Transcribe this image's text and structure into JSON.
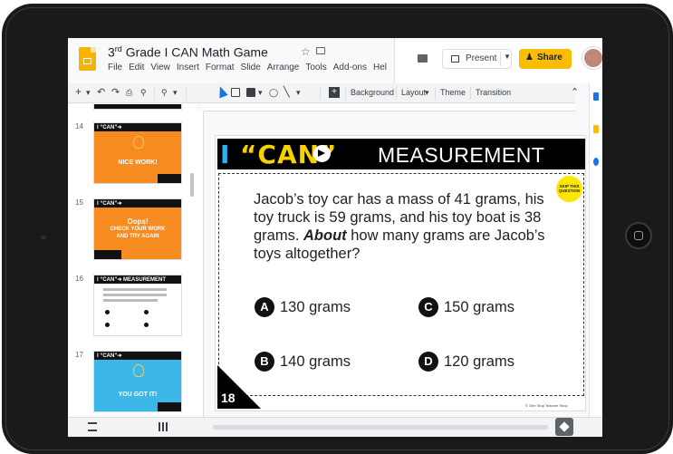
{
  "document": {
    "title_prefix": "3",
    "title_sup": "rd",
    "title_rest": " Grade I CAN Math Game"
  },
  "menu": [
    "File",
    "Edit",
    "View",
    "Insert",
    "Format",
    "Slide",
    "Arrange",
    "Tools",
    "Add-ons",
    "Hel"
  ],
  "header": {
    "present_label": "Present",
    "share_label": "Share"
  },
  "toolbar": {
    "background_label": "Background",
    "layout_label": "Layout",
    "theme_label": "Theme",
    "transition_label": "Transition"
  },
  "filmstrip": {
    "slides": [
      {
        "number": "14",
        "message": "NICE WORK!",
        "color": "#f68b1f"
      },
      {
        "number": "15",
        "message_line1": "Oops!",
        "message_line2": "CHECK YOUR WORK",
        "message_line3": "AND TRY AGAIN",
        "color": "#f68b1f"
      },
      {
        "number": "16",
        "color": "#ffffff"
      },
      {
        "number": "17",
        "message": "YOU GOT IT!",
        "color": "#3bb7e8"
      }
    ]
  },
  "slide": {
    "logo_i": "I",
    "logo_can": "“CAN”",
    "title": "MEASUREMENT",
    "skip_badge_line1": "SKIP THIS",
    "skip_badge_line2": "QUESTION",
    "question_part1": "Jacob’s toy car has a mass of 41 grams, his toy truck is 59 grams, and his toy boat is 38 grams. ",
    "question_emphasis": "About",
    "question_part2": " how many grams are Jacob’s toys altogether?",
    "answers": [
      {
        "letter": "A",
        "text": "130 grams"
      },
      {
        "letter": "C",
        "text": "150 grams"
      },
      {
        "letter": "B",
        "text": "140 grams"
      },
      {
        "letter": "D",
        "text": "120 grams"
      }
    ],
    "number": "18",
    "copyright": "© One Stop Teacher Shop"
  },
  "colors": {
    "accent_orange": "#f68b1f",
    "accent_blue": "#3bb7e8",
    "share_yellow": "#fbbc04",
    "logo_cyan": "#2ab3f0",
    "logo_yellow": "#f6d000",
    "logo_pink": "#ec3a8e"
  }
}
